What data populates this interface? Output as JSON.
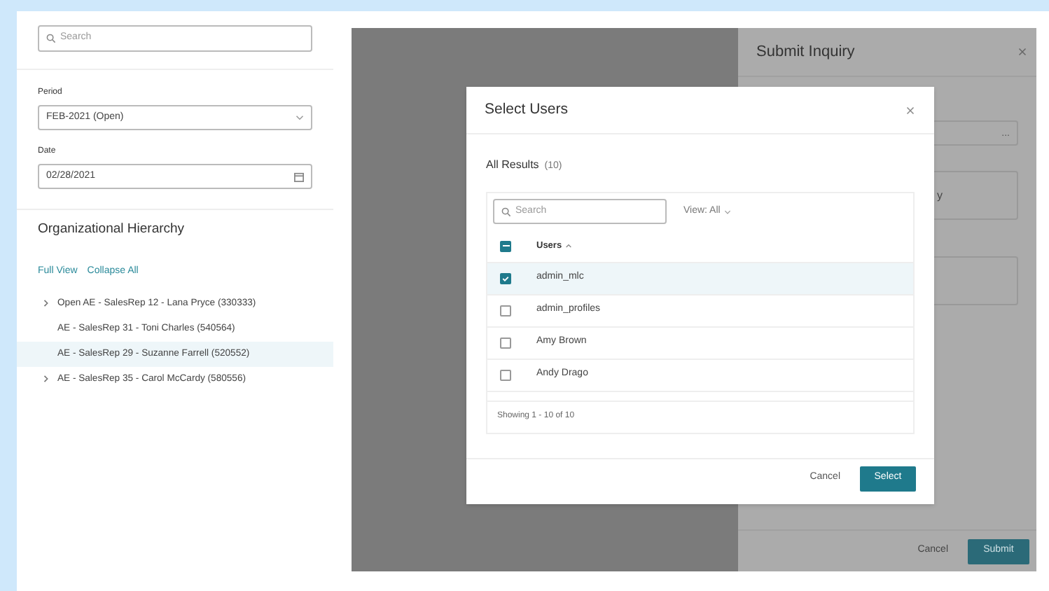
{
  "sidebar": {
    "search": {
      "placeholder": "Search"
    },
    "period": {
      "label": "Period",
      "value": "FEB-2021 (Open)"
    },
    "date": {
      "label": "Date",
      "value": "02/28/2021"
    },
    "hierarchy": {
      "title": "Organizational Hierarchy",
      "links": [
        "Full View",
        "Collapse All"
      ],
      "items": [
        {
          "label": "Open AE - SalesRep 12 - Lana Pryce (330333)",
          "kind": "group",
          "expanded": false,
          "selected": false
        },
        {
          "label": "AE - SalesRep 31 - Toni Charles (540564)",
          "kind": "leaf",
          "selected": false
        },
        {
          "label": "AE - SalesRep 29 - Suzanne Farrell (520552)",
          "kind": "leaf",
          "selected": true
        },
        {
          "label": "AE - SalesRep 35 - Carol McCardy (580556)",
          "kind": "group",
          "expanded": false,
          "selected": false
        }
      ]
    }
  },
  "drawer": {
    "title": "Submit Inquiry",
    "field_1": {
      "button": "..."
    },
    "field_2": {
      "value": "y"
    },
    "buttons": [
      "Cancel",
      "Submit"
    ]
  },
  "modal": {
    "title": "Select Users",
    "results_label": "All Results",
    "results_count": "(10)",
    "search": {
      "placeholder": "Search"
    },
    "view_filter": "View: All",
    "column": "Users",
    "select_all": {
      "checked": true,
      "indeterminate": true
    },
    "rows": [
      {
        "name": "admin_mlc",
        "checked": true,
        "selected": true
      },
      {
        "name": "admin_profiles",
        "checked": false,
        "selected": false
      },
      {
        "name": "Amy Brown",
        "checked": false,
        "selected": false
      },
      {
        "name": "Andy Drago",
        "checked": false,
        "selected": false
      }
    ],
    "footer": "Showing 1 - 10 of 10",
    "buttons": [
      "Cancel",
      "Select"
    ]
  }
}
